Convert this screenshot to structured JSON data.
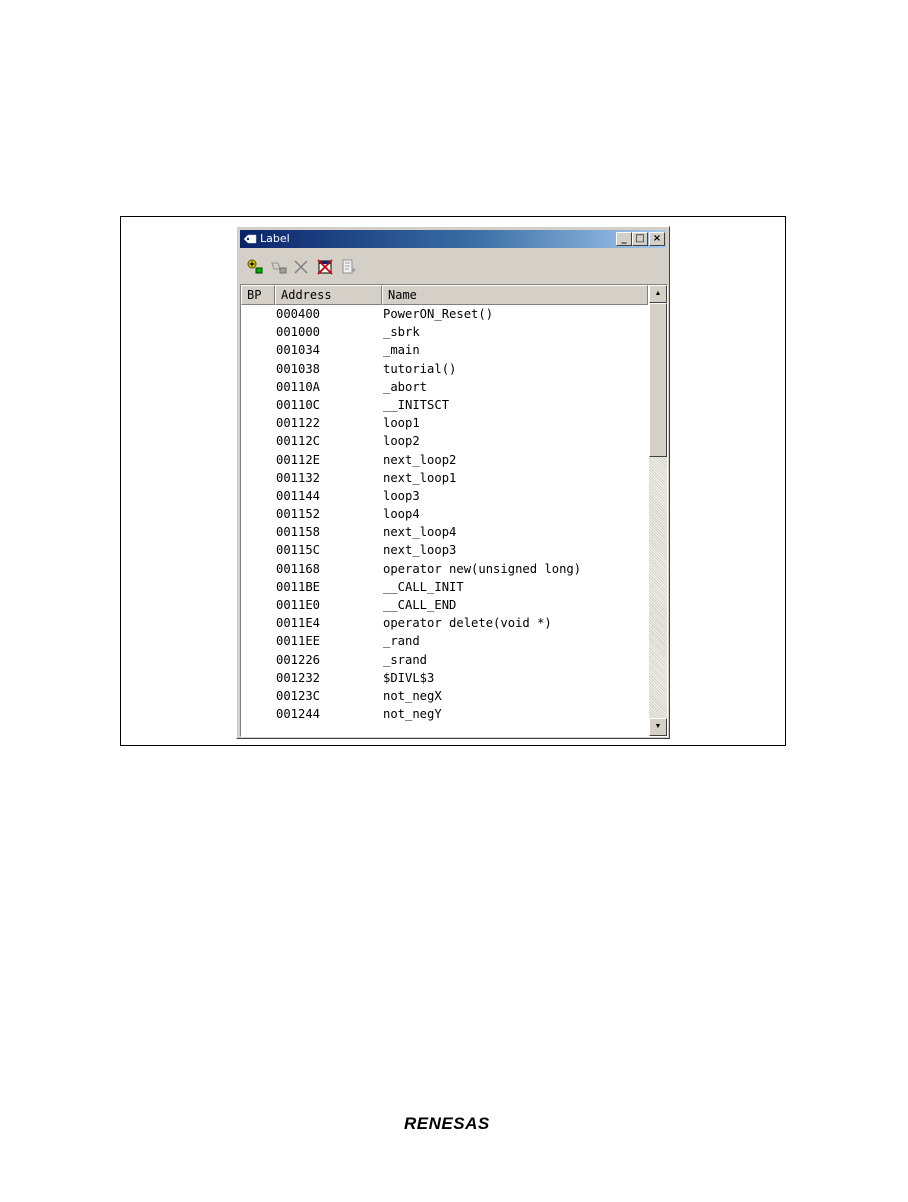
{
  "window": {
    "title": "Label",
    "minimize_glyph": "_",
    "maximize_glyph": "□",
    "close_glyph": "×"
  },
  "toolbar": {
    "icons": [
      "add-label-icon",
      "edit-label-icon",
      "delete-label-icon",
      "delete-all-labels-icon",
      "refresh-icon"
    ]
  },
  "table": {
    "columns": [
      "BP",
      "Address",
      "Name"
    ],
    "rows": [
      {
        "address": "000400",
        "name": "PowerON_Reset()"
      },
      {
        "address": "001000",
        "name": "_sbrk"
      },
      {
        "address": "001034",
        "name": "_main"
      },
      {
        "address": "001038",
        "name": "tutorial()"
      },
      {
        "address": "00110A",
        "name": "_abort"
      },
      {
        "address": "00110C",
        "name": "__INITSCT"
      },
      {
        "address": "001122",
        "name": "loop1"
      },
      {
        "address": "00112C",
        "name": "loop2"
      },
      {
        "address": "00112E",
        "name": "next_loop2"
      },
      {
        "address": "001132",
        "name": "next_loop1"
      },
      {
        "address": "001144",
        "name": "loop3"
      },
      {
        "address": "001152",
        "name": "loop4"
      },
      {
        "address": "001158",
        "name": "next_loop4"
      },
      {
        "address": "00115C",
        "name": "next_loop3"
      },
      {
        "address": "001168",
        "name": "operator new(unsigned long)"
      },
      {
        "address": "0011BE",
        "name": "__CALL_INIT"
      },
      {
        "address": "0011E0",
        "name": "__CALL_END"
      },
      {
        "address": "0011E4",
        "name": "operator delete(void *)"
      },
      {
        "address": "0011EE",
        "name": "_rand"
      },
      {
        "address": "001226",
        "name": "_srand"
      },
      {
        "address": "001232",
        "name": "$DIVL$3"
      },
      {
        "address": "00123C",
        "name": "not_negX"
      },
      {
        "address": "001244",
        "name": "not_negY"
      }
    ]
  },
  "scrollbar": {
    "up_glyph": "▲",
    "down_glyph": "▼"
  },
  "footer": {
    "logo_text": "RENESAS"
  },
  "colors": {
    "title_bar_start": "#0a246a",
    "title_bar_end": "#a6caf0",
    "window_face": "#d4d0c8"
  }
}
